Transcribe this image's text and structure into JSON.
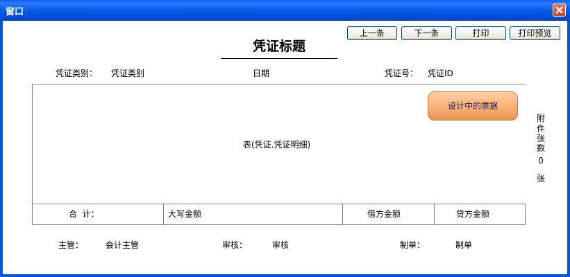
{
  "window": {
    "title": "窗口"
  },
  "toolbar": {
    "prev": "上一条",
    "next": "下一条",
    "print": "打印",
    "preview": "打印预览"
  },
  "voucher": {
    "title": "凭证标题",
    "type_label": "凭证类别：",
    "type_value": "凭证类别",
    "date_label": "日期",
    "number_label": "凭证号：",
    "number_value": "凭证ID",
    "table_text": "表(凭证.凭证明细)",
    "design_button": "设计中的票据",
    "attachments": {
      "chars": [
        "附",
        "件",
        "张",
        "数"
      ],
      "count": "0",
      "unit": "张"
    },
    "totals": {
      "label": "合  计：",
      "uppercase_amount": "大写金额",
      "debit": "借方金额",
      "credit": "贷方金额"
    },
    "footer": {
      "supervisor_label": "主管：",
      "supervisor_value": "会计主管",
      "review_label": "审核：",
      "review_value": "审核",
      "maker_label": "制单：",
      "maker_value": "制单"
    }
  },
  "colors": {
    "titlebar": "#0058e8",
    "design_button": "#f5a86a"
  }
}
